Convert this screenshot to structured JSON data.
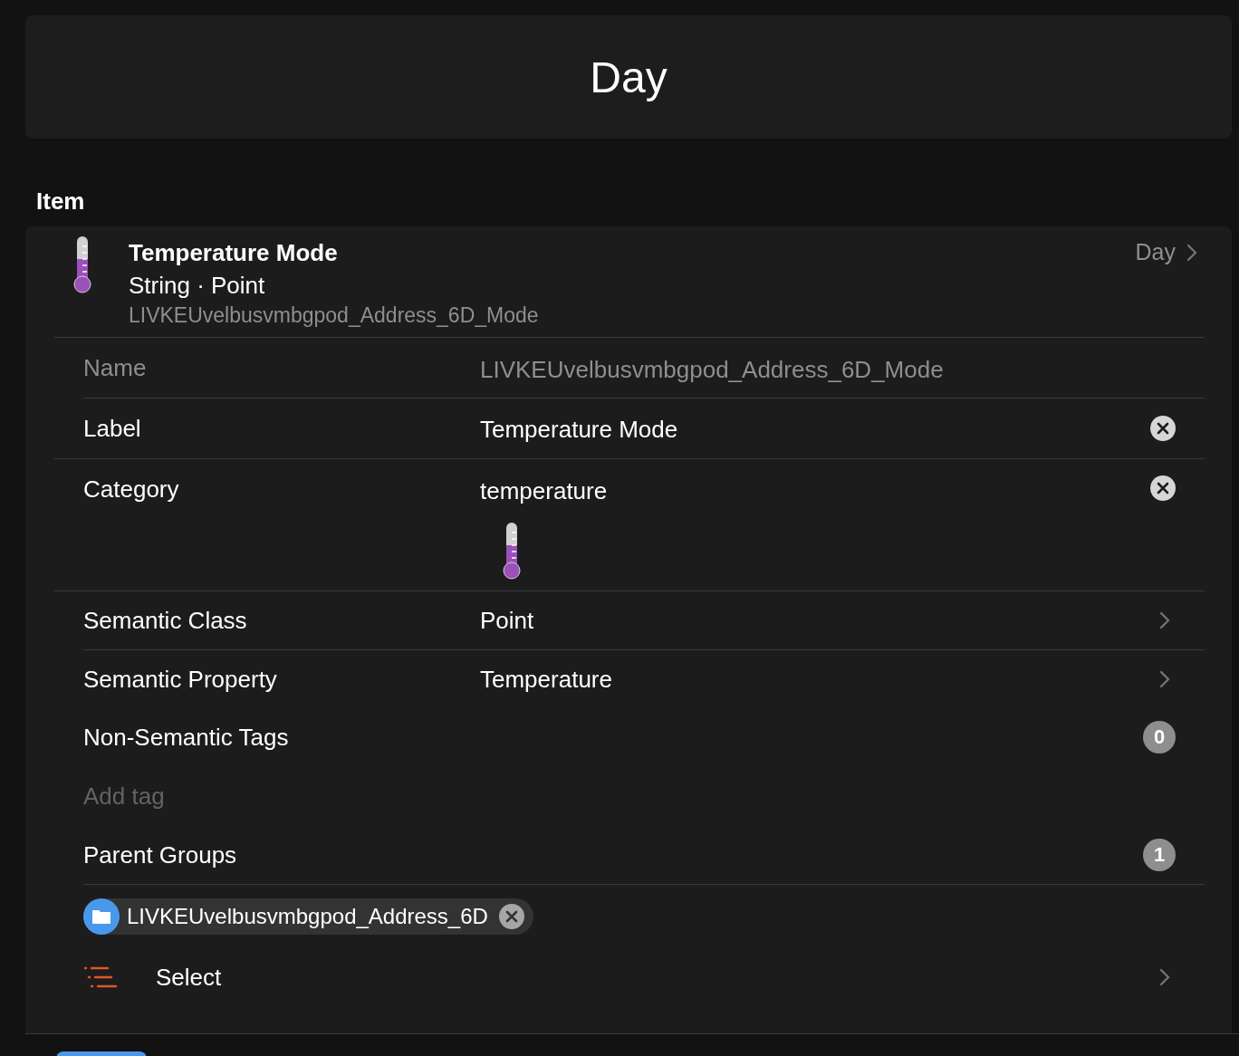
{
  "header": {
    "title": "Day"
  },
  "section": {
    "title": "Item"
  },
  "item": {
    "label": "Temperature Mode",
    "type_line": "String · Point",
    "name": "LIVKEUvelbusvmbgpod_Address_6D_Mode",
    "state": "Day"
  },
  "rows": [
    {
      "kind": "readonly",
      "label": "Name",
      "value": "LIVKEUvelbusvmbgpod_Address_6D_Mode"
    },
    {
      "kind": "clearable",
      "label": "Label",
      "value": "Temperature Mode"
    },
    {
      "kind": "category",
      "label": "Category",
      "value": "temperature"
    },
    {
      "kind": "link",
      "label": "Semantic Class",
      "value": "Point"
    },
    {
      "kind": "link",
      "label": "Semantic Property",
      "value": "Temperature"
    },
    {
      "kind": "count",
      "label": "Non-Semantic Tags",
      "count": "0"
    },
    {
      "kind": "placeholder",
      "placeholder": "Add tag"
    },
    {
      "kind": "count",
      "label": "Parent Groups",
      "count": "1"
    },
    {
      "kind": "chip",
      "value": "LIVKEUvelbusvmbgpod_Address_6D"
    },
    {
      "kind": "select",
      "label": "Select"
    }
  ]
}
